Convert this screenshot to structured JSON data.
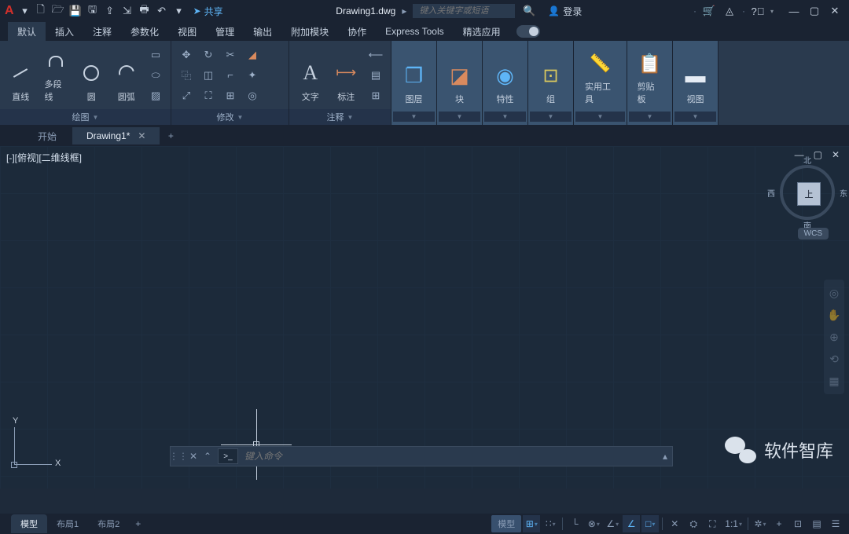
{
  "titlebar": {
    "share_label": "共享",
    "document_title": "Drawing1.dwg",
    "search_placeholder": "键入关键字或短语",
    "login_label": "登录"
  },
  "ribbon_tabs": [
    "默认",
    "插入",
    "注释",
    "参数化",
    "视图",
    "管理",
    "输出",
    "附加模块",
    "协作",
    "Express Tools",
    "精选应用"
  ],
  "ribbon": {
    "draw": {
      "title": "绘图",
      "line": "直线",
      "polyline": "多段线",
      "circle": "圆",
      "arc": "圆弧"
    },
    "modify": {
      "title": "修改"
    },
    "annotate": {
      "title": "注释",
      "text": "文字",
      "dim": "标注"
    },
    "layers": {
      "title": "图层"
    },
    "block": {
      "title": "块"
    },
    "properties": {
      "title": "特性"
    },
    "group": {
      "title": "组"
    },
    "utilities": {
      "title": "实用工具"
    },
    "clipboard": {
      "title": "剪贴板"
    },
    "view": {
      "title": "视图"
    }
  },
  "doc_tabs": {
    "start": "开始",
    "active": "Drawing1*"
  },
  "viewport_label": "[-][俯视][二维线框]",
  "viewcube": {
    "face": "上",
    "n": "北",
    "s": "南",
    "e": "东",
    "w": "西",
    "wcs": "WCS"
  },
  "ucs": {
    "x": "X",
    "y": "Y"
  },
  "cmdline": {
    "placeholder": "键入命令",
    "prompt": ">_"
  },
  "layout_tabs": [
    "模型",
    "布局1",
    "布局2"
  ],
  "statusbar": {
    "model": "模型",
    "scale": "1:1"
  },
  "watermark": "软件智库"
}
